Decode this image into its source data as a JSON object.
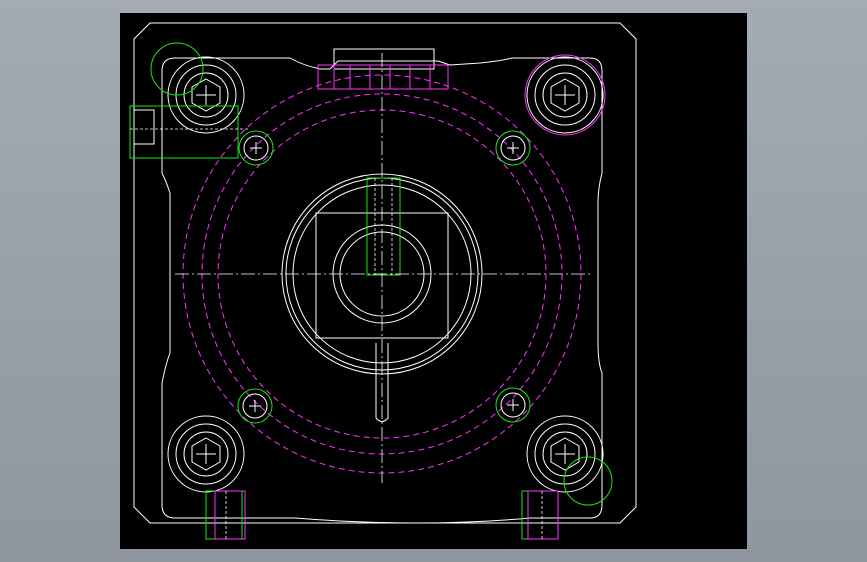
{
  "colors": {
    "background": "#000000",
    "outline": "#ffffff",
    "hidden": "#ff33ff",
    "highlight": "#19e619",
    "frame": "#9aa1aa"
  },
  "drawing": {
    "kind": "cad-top-view",
    "corner_bolts": 4,
    "pin_holes": 4,
    "text_labels": []
  }
}
